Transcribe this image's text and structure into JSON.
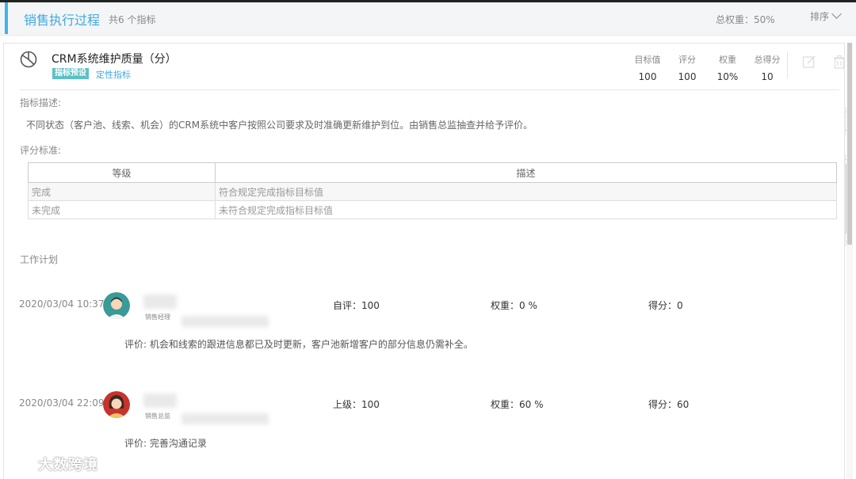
{
  "header": {
    "title": "销售执行过程",
    "count_text": "共6 个指标",
    "weight_text": "总权重：50%",
    "sort_label": "排序"
  },
  "indicator": {
    "icon": "pie-chart-icon",
    "title": "CRM系统维护质量（分）",
    "tag_preset": "指标预设",
    "tag_type": "定性指标",
    "stats": [
      {
        "label": "目标值",
        "value": "100"
      },
      {
        "label": "评分",
        "value": "100"
      },
      {
        "label": "权重",
        "value": "10%"
      },
      {
        "label": "总得分",
        "value": "10"
      }
    ],
    "actions": [
      "edit-icon",
      "trash-icon"
    ],
    "description_label": "指标描述:",
    "description": "不同状态（客户池、线索、机会）的CRM系统中客户按照公司要求及时准确更新维护到位。由销售总监抽查并给予评价。",
    "criteria_label": "评分标准:",
    "criteria_headers": [
      "等级",
      "描述"
    ],
    "criteria_rows": [
      {
        "level": "完成",
        "desc": "符合规定完成指标目标值"
      },
      {
        "level": "未完成",
        "desc": "未符合规定完成指标目标值"
      }
    ],
    "work_plan_label": "工作计划"
  },
  "logs": [
    {
      "time": "2020/03/04 10:37",
      "role": "销售经理",
      "avatar": "male-avatar",
      "score_text": "自评：100",
      "weight_text": "权重：0 %",
      "result_text": "得分：0",
      "comment": "评价: 机会和线索的跟进信息都已及时更新，客户池新增客户的部分信息仍需补全。"
    },
    {
      "time": "2020/03/04 22:09",
      "role": "销售总监",
      "avatar": "female-avatar",
      "score_text": "上级：100",
      "weight_text": "权重：60 %",
      "result_text": "得分：60",
      "comment": "评价: 完善沟通记录"
    }
  ],
  "watermark": "大数跨境",
  "colors": {
    "accent": "#3fb4e8",
    "tag": "#5cc0c5"
  }
}
